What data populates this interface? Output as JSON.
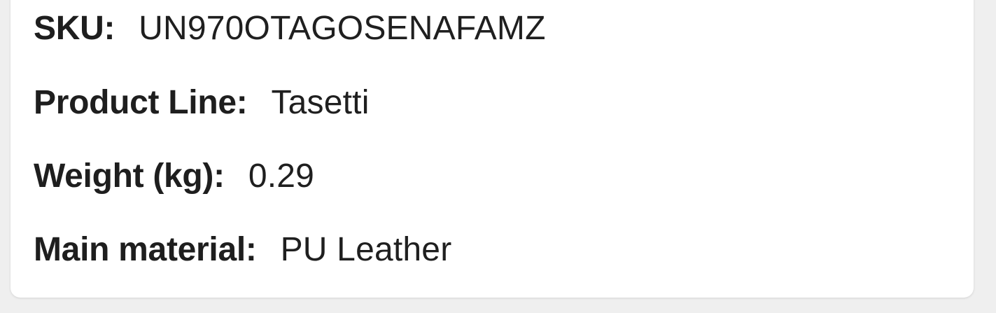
{
  "product_details": {
    "rows": [
      {
        "label": "SKU:",
        "value": "UN970OTAGOSENAFAMZ"
      },
      {
        "label": "Product Line:",
        "value": "Tasetti"
      },
      {
        "label": "Weight (kg):",
        "value": "0.29"
      },
      {
        "label": "Main material:",
        "value": "PU Leather"
      }
    ]
  }
}
